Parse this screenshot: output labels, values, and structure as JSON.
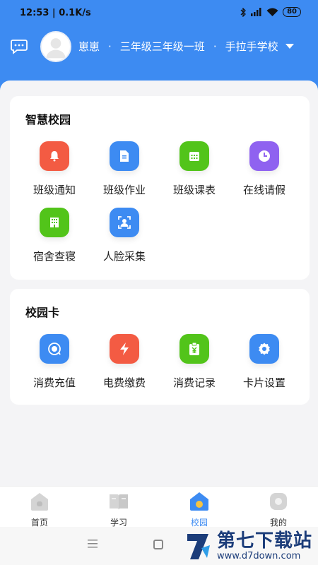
{
  "status": {
    "time": "12:53",
    "speed": "0.1K/s",
    "battery": "80"
  },
  "user": {
    "name": "崽崽",
    "class": "三年级三年级一班",
    "school": "手拉手学校",
    "sep": "·"
  },
  "smart_campus": {
    "title": "智慧校园",
    "items": [
      {
        "label": "班级通知",
        "icon": "bell-icon",
        "color": "#f35b43"
      },
      {
        "label": "班级作业",
        "icon": "document-icon",
        "color": "#3d8bf2"
      },
      {
        "label": "班级课表",
        "icon": "calendar-icon",
        "color": "#52c41a"
      },
      {
        "label": "在线请假",
        "icon": "clock-icon",
        "color": "#8f62f0"
      },
      {
        "label": "宿舍查寝",
        "icon": "building-icon",
        "color": "#52c41a"
      },
      {
        "label": "人脸采集",
        "icon": "face-scan-icon",
        "color": "#3d8bf2"
      }
    ]
  },
  "campus_card": {
    "title": "校园卡",
    "items": [
      {
        "label": "消费充值",
        "icon": "recharge-icon",
        "color": "#3d8bf2"
      },
      {
        "label": "电费缴费",
        "icon": "lightning-icon",
        "color": "#f35b43"
      },
      {
        "label": "消费记录",
        "icon": "yuan-receipt-icon",
        "color": "#52c41a"
      },
      {
        "label": "卡片设置",
        "icon": "settings-icon",
        "color": "#3d8bf2"
      }
    ]
  },
  "tabs": [
    {
      "label": "首页",
      "icon": "home-icon",
      "active": false
    },
    {
      "label": "学习",
      "icon": "book-icon",
      "active": false
    },
    {
      "label": "校园",
      "icon": "school-icon",
      "active": true
    },
    {
      "label": "我的",
      "icon": "profile-icon",
      "active": false
    }
  ],
  "watermark": {
    "main": "第七下载站",
    "url": "www.d7down.com"
  }
}
